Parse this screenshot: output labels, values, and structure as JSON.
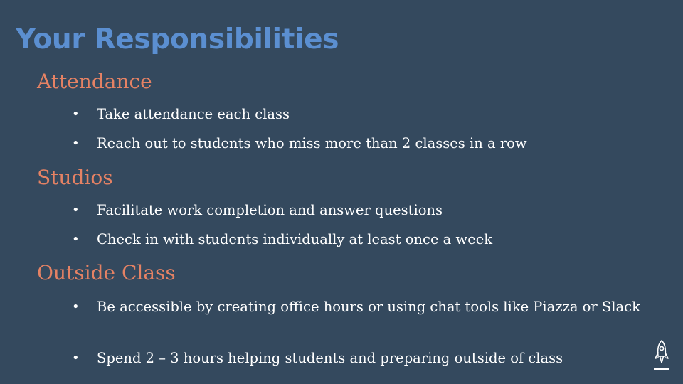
{
  "slide": {
    "title": "Your Responsibilities",
    "sections": [
      {
        "heading": "Attendance",
        "bullets": [
          "Take attendance each class",
          "Reach out to students who miss more than 2 classes in a row"
        ]
      },
      {
        "heading": "Studios",
        "bullets": [
          "Facilitate work completion and answer questions",
          "Check in with students individually at least once a week"
        ]
      },
      {
        "heading": "Outside Class",
        "bullets": [
          "Be accessible by creating office hours or using chat tools like Piazza or Slack",
          "Spend 2 – 3 hours helping students and preparing outside of class"
        ]
      }
    ],
    "bullet_glyph": "•",
    "logo_icon": "rocket-icon"
  },
  "colors": {
    "background": "#34495e",
    "title": "#5b8fd1",
    "heading": "#e58264",
    "body_text": "#ffffff"
  }
}
